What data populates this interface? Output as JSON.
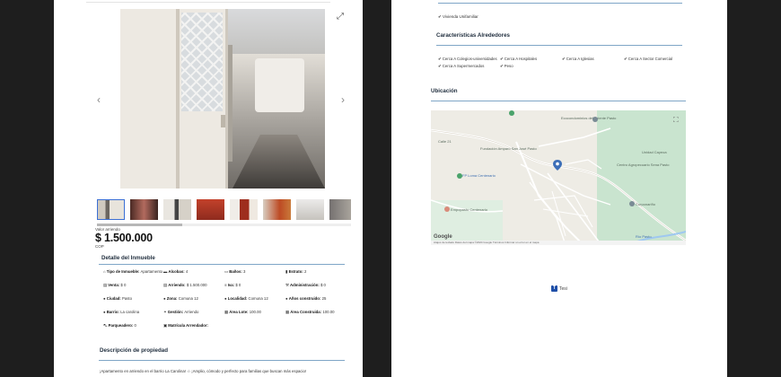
{
  "left_page": {
    "price_label": "Valor arriendo",
    "price": "$ 1.500.000",
    "currency": "COP",
    "detail_title": "Detalle del Inmueble",
    "details": [
      {
        "icon": "home-icon",
        "label": "Tipo de Inmueble:",
        "value": "Apartamento"
      },
      {
        "icon": "bed-icon",
        "label": "Alcobas:",
        "value": "4"
      },
      {
        "icon": "bath-icon",
        "label": "Baños:",
        "value": "3"
      },
      {
        "icon": "bars-icon",
        "label": "Estrato:",
        "value": "2"
      },
      {
        "icon": "money-icon",
        "label": "Venta:",
        "value": "$ 0"
      },
      {
        "icon": "money-icon",
        "label": "Arriendo:",
        "value": "$ 1.500.000"
      },
      {
        "icon": "list-icon",
        "label": "Iva:",
        "value": "$ 0"
      },
      {
        "icon": "tool-icon",
        "label": "Administración:",
        "value": "$ 0"
      },
      {
        "icon": "location-pin-icon",
        "label": "Ciudad:",
        "value": "Pasto"
      },
      {
        "icon": "location-pin-icon",
        "label": "Zona:",
        "value": "Comuna 12"
      },
      {
        "icon": "location-pin-icon",
        "label": "Localidad:",
        "value": "Comuna 12"
      },
      {
        "icon": "location-pin-icon",
        "label": "Años construido:",
        "value": "25"
      },
      {
        "icon": "location-pin-icon",
        "label": "Barrio:",
        "value": "La carolina"
      },
      {
        "icon": "handshake-icon",
        "label": "Gestión:",
        "value": "Arriendo"
      },
      {
        "icon": "grid-icon",
        "label": "Área Lote:",
        "value": "100.00"
      },
      {
        "icon": "grid-icon",
        "label": "Área Construida:",
        "value": "100.00"
      },
      {
        "icon": "car-icon",
        "label": "Parqueadero:",
        "value": "0"
      },
      {
        "icon": "id-card-icon",
        "label": "Matrícula Arrendador:",
        "value": ""
      }
    ],
    "description_title": "Descripción de propiedad",
    "description_text": "¡Apartamento en arriendo en el barrio La Carolina! ☆ ¡Amplio, cómodo y perfecto para familias que buscan más espacio!"
  },
  "right_page": {
    "vivienda": "✔ Vivienda Unifamiliar",
    "caracteristicas_title": "Características Alrededores",
    "caracteristicas": [
      "✔ Cerca A Colegios-universidades",
      "✔ Cerca A Hospitales",
      "✔ Cerca A Iglesias",
      "✔ Cerca A Sector Comercial",
      "✔ Cerca A Supermercados",
      "✔ Peso"
    ],
    "ubicacion_title": "Ubicación",
    "map": {
      "labels": {
        "ecoconsorcios": "Ecocondominios del Oriente Pasto",
        "fundacion": "Fundación Amparo San José Pasto",
        "calle21": "Calle 21",
        "lomo": "FP Loma Centenario",
        "centro_agro": "Centro Agropecuario Sena Pasto",
        "unidad": "Unidad Cayeoa",
        "empopasto": "Empopasto Centenario",
        "corponarino": "Corponariño",
        "rio": "Río Pasto",
        "google": "Google"
      },
      "footer": "Atajos de teclado  Datos del mapa ©2024 Google  Términos  Informar un error en el mapa"
    },
    "brand": "Tesi"
  },
  "colors": {
    "accent_rule": "#7fa6c7",
    "active_thumb": "#3b6fd4",
    "pin": "#3d6fb8"
  }
}
